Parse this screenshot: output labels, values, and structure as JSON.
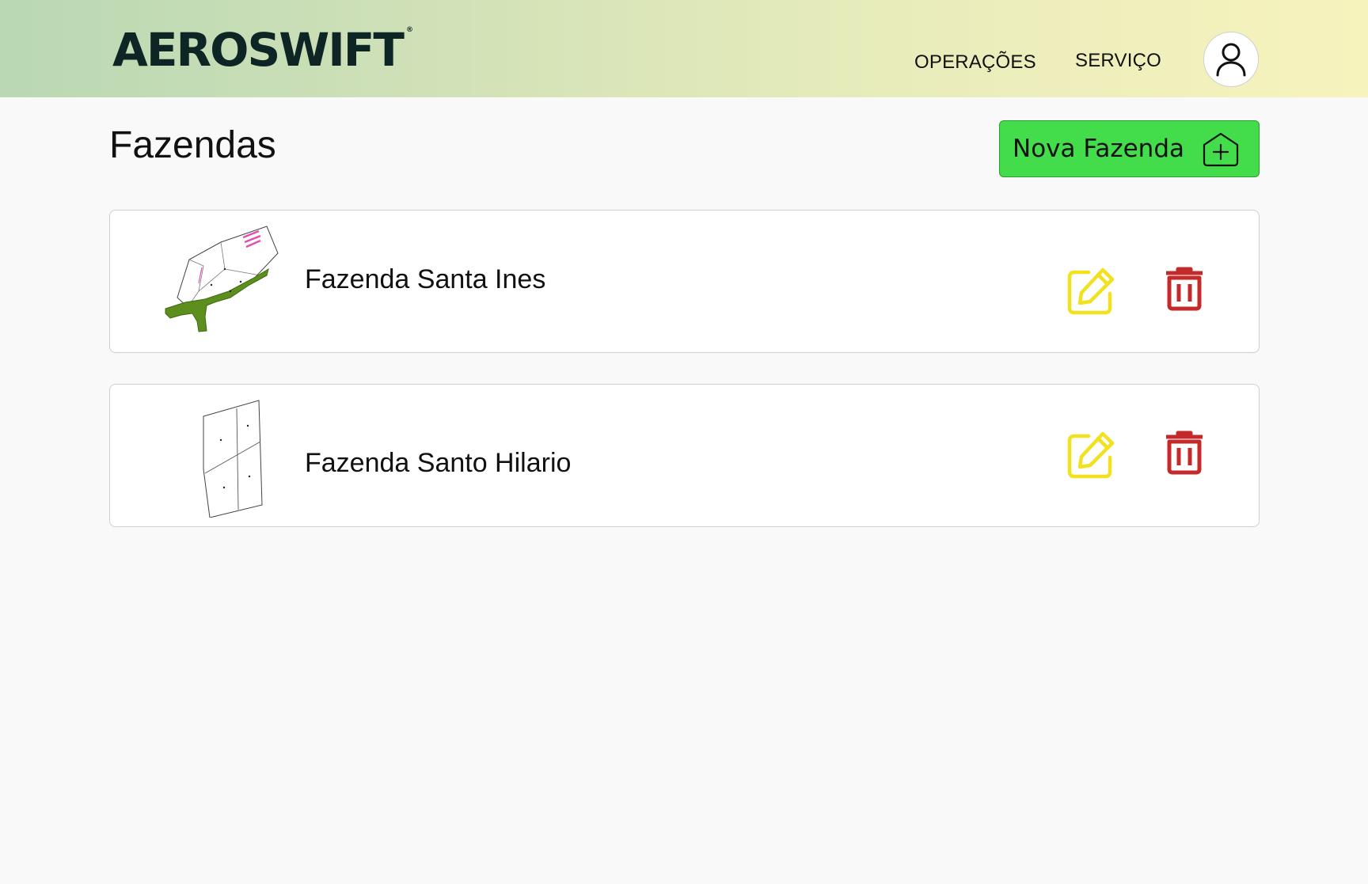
{
  "header": {
    "logo_text": "AEROSWIFT",
    "logo_mark": "®",
    "nav": [
      {
        "label": "OPERAÇÕES"
      },
      {
        "label": "SERVIÇO"
      }
    ],
    "avatar_icon": "user-icon"
  },
  "main": {
    "title": "Fazendas",
    "new_button": {
      "label": "Nova Fazenda",
      "icon": "add-house-icon"
    },
    "farms": [
      {
        "name": "Fazenda Santa Ines",
        "edit_icon": "edit-icon",
        "delete_icon": "trash-icon"
      },
      {
        "name": "Fazenda Santo Hilario",
        "edit_icon": "edit-icon",
        "delete_icon": "trash-icon"
      }
    ]
  },
  "colors": {
    "header_gradient_start": "#b9d8b3",
    "header_gradient_end": "#f7f3bd",
    "primary_button": "#43dd4b",
    "edit_icon": "#f2e21e",
    "delete_icon": "#c42a2a",
    "logo": "#0e2525"
  }
}
